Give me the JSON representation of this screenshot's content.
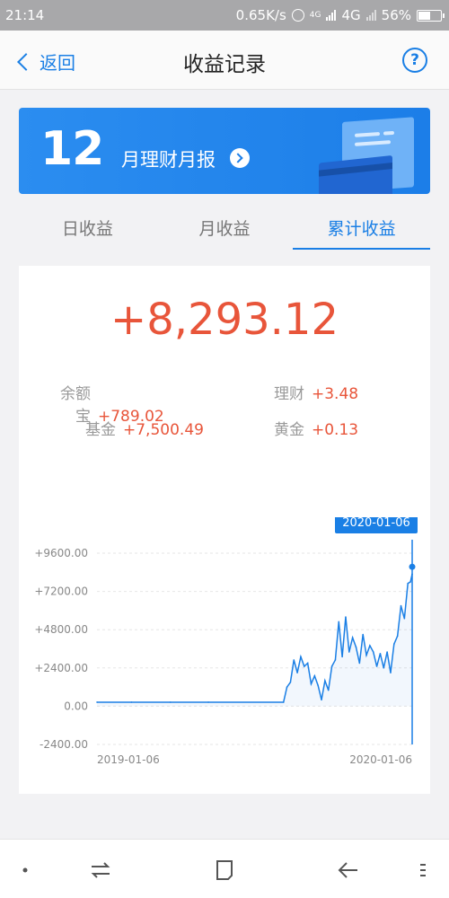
{
  "status_bar": {
    "time": "21:14",
    "speed": "0.65K/s",
    "network_small": "4G",
    "network": "4G",
    "battery": "56%",
    "battery_level": 0.56
  },
  "header": {
    "back_label": "返回",
    "title": "收益记录",
    "help_label": "?"
  },
  "banner": {
    "month": "12",
    "label": "月理财月报"
  },
  "tabs": [
    {
      "label": "日收益",
      "active": false
    },
    {
      "label": "月收益",
      "active": false
    },
    {
      "label": "累计收益",
      "active": true
    }
  ],
  "summary": {
    "total": "+8,293.12",
    "items": [
      {
        "name": "余额宝",
        "value": "+789.02"
      },
      {
        "name": "理财",
        "value": "+3.48"
      },
      {
        "name": "基金",
        "value": "+7,500.49"
      },
      {
        "name": "黄金",
        "value": "+0.13"
      }
    ]
  },
  "chart_data": {
    "type": "line",
    "title": "",
    "xlabel": "",
    "ylabel": "",
    "x_tick_labels": [
      "2019-01-06",
      "2020-01-06"
    ],
    "y_tick_labels": [
      "+9600.00",
      "+7200.00",
      "+4800.00",
      "+2400.00",
      "0.00",
      "-2400.00"
    ],
    "ylim": [
      -2400,
      9600
    ],
    "xlim": [
      "2019-01-06",
      "2020-01-06"
    ],
    "tooltip": "2020-01-06",
    "grid": true,
    "color": "#1a7fe5",
    "series": [
      {
        "x": [
          "2019-01-06",
          "2019-02-15",
          "2019-04-01",
          "2019-05-15",
          "2019-08-10",
          "2019-08-14",
          "2019-08-18",
          "2019-08-22",
          "2019-08-26",
          "2019-08-30",
          "2019-09-03",
          "2019-09-07",
          "2019-09-11",
          "2019-09-15",
          "2019-09-19",
          "2019-09-23",
          "2019-09-27",
          "2019-10-01",
          "2019-10-05",
          "2019-10-09",
          "2019-10-13",
          "2019-10-17",
          "2019-10-21",
          "2019-10-25",
          "2019-10-29",
          "2019-11-02",
          "2019-11-06",
          "2019-11-10",
          "2019-11-14",
          "2019-11-18",
          "2019-11-22",
          "2019-11-26",
          "2019-11-30",
          "2019-12-04",
          "2019-12-08",
          "2019-12-12",
          "2019-12-16",
          "2019-12-20",
          "2019-12-24",
          "2019-12-28",
          "2020-01-01",
          "2020-01-04",
          "2020-01-06"
        ],
        "y": [
          250,
          250,
          250,
          250,
          250,
          1200,
          1500,
          2900,
          2100,
          3100,
          2500,
          2700,
          1400,
          1900,
          1300,
          400,
          1600,
          1000,
          2500,
          2900,
          5300,
          3100,
          5600,
          3400,
          4300,
          3700,
          2700,
          4500,
          3200,
          3800,
          3400,
          2500,
          3300,
          2400,
          3400,
          2100,
          3900,
          4400,
          6300,
          5500,
          7700,
          7800,
          8293
        ]
      }
    ]
  }
}
